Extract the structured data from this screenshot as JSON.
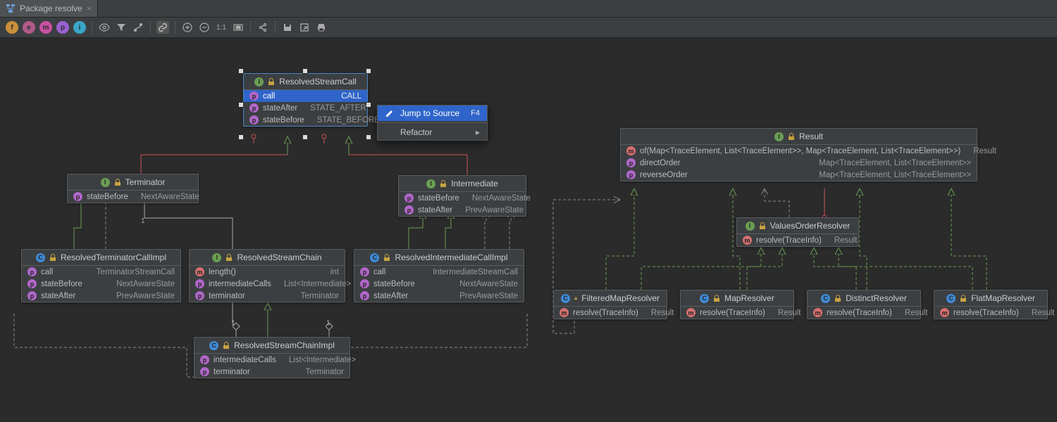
{
  "tab": {
    "title": "Package resolve"
  },
  "toolbar_circles": [
    "f",
    "e",
    "m",
    "p",
    "i"
  ],
  "context_menu": {
    "jump": "Jump to Source",
    "jump_key": "F4",
    "refactor": "Refactor"
  },
  "classes": {
    "rsc": {
      "name": "ResolvedStreamCall",
      "rows": [
        {
          "k": "p",
          "n": "call",
          "t": "CALL",
          "sel": true
        },
        {
          "k": "p",
          "n": "stateAfter",
          "t": "STATE_AFTER"
        },
        {
          "k": "p",
          "n": "stateBefore",
          "t": "STATE_BEFORE"
        }
      ]
    },
    "term": {
      "name": "Terminator",
      "rows": [
        {
          "k": "p",
          "n": "stateBefore",
          "t": "NextAwareState"
        }
      ]
    },
    "inter": {
      "name": "Intermediate",
      "rows": [
        {
          "k": "p",
          "n": "stateBefore",
          "t": "NextAwareState"
        },
        {
          "k": "p",
          "n": "stateAfter",
          "t": "PrevAwareState"
        }
      ]
    },
    "rtci": {
      "name": "ResolvedTerminatorCallImpl",
      "rows": [
        {
          "k": "p",
          "n": "call",
          "t": "TerminatorStreamCall"
        },
        {
          "k": "p",
          "n": "stateBefore",
          "t": "NextAwareState"
        },
        {
          "k": "p",
          "n": "stateAfter",
          "t": "PrevAwareState"
        }
      ]
    },
    "rschain": {
      "name": "ResolvedStreamChain",
      "rows": [
        {
          "k": "m",
          "n": "length()",
          "t": "int"
        },
        {
          "k": "p",
          "n": "intermediateCalls",
          "t": "List<Intermediate>"
        },
        {
          "k": "p",
          "n": "terminator",
          "t": "Terminator"
        }
      ]
    },
    "rici": {
      "name": "ResolvedIntermediateCallImpl",
      "rows": [
        {
          "k": "p",
          "n": "call",
          "t": "IntermediateStreamCall"
        },
        {
          "k": "p",
          "n": "stateBefore",
          "t": "NextAwareState"
        },
        {
          "k": "p",
          "n": "stateAfter",
          "t": "PrevAwareState"
        }
      ]
    },
    "rscimpl": {
      "name": "ResolvedStreamChainImpl",
      "rows": [
        {
          "k": "p",
          "n": "intermediateCalls",
          "t": "List<Intermediate>"
        },
        {
          "k": "p",
          "n": "terminator",
          "t": "Terminator"
        }
      ]
    },
    "result": {
      "name": "Result",
      "rows": [
        {
          "k": "m",
          "n": "of(Map<TraceElement, List<TraceElement>>, Map<TraceElement, List<TraceElement>>)",
          "t": "Result"
        },
        {
          "k": "p",
          "n": "directOrder",
          "t": "Map<TraceElement, List<TraceElement>>"
        },
        {
          "k": "p",
          "n": "reverseOrder",
          "t": "Map<TraceElement, List<TraceElement>>"
        }
      ]
    },
    "vor": {
      "name": "ValuesOrderResolver",
      "rows": [
        {
          "k": "m",
          "n": "resolve(TraceInfo)",
          "t": "Result"
        }
      ]
    },
    "fmr": {
      "name": "FilteredMapResolver",
      "rows": [
        {
          "k": "m",
          "n": "resolve(TraceInfo)",
          "t": "Result"
        }
      ]
    },
    "mr": {
      "name": "MapResolver",
      "rows": [
        {
          "k": "m",
          "n": "resolve(TraceInfo)",
          "t": "Result"
        }
      ]
    },
    "dr": {
      "name": "DistinctResolver",
      "rows": [
        {
          "k": "m",
          "n": "resolve(TraceInfo)",
          "t": "Result"
        }
      ]
    },
    "fmr2": {
      "name": "FlatMapResolver",
      "rows": [
        {
          "k": "m",
          "n": "resolve(TraceInfo)",
          "t": "Result"
        }
      ]
    }
  },
  "mult": {
    "m1": "1",
    "m2": "1",
    "m3": "1",
    "m4": "*",
    "m5": "*"
  }
}
